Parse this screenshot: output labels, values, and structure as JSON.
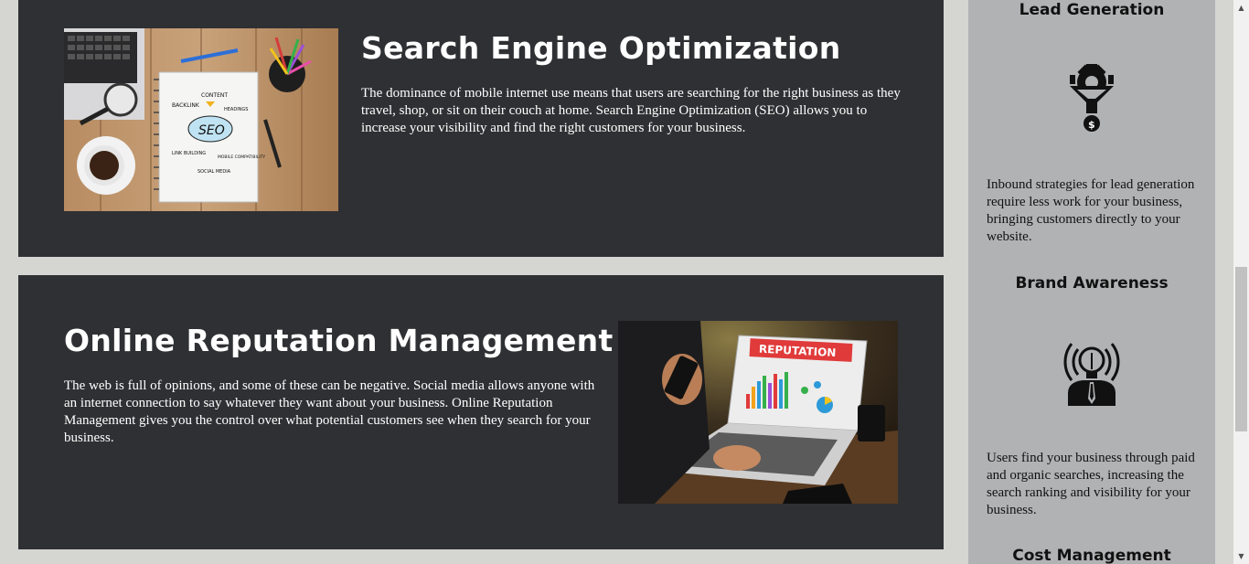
{
  "services": {
    "seo": {
      "title": "Search Engine Optimization",
      "description": "The dominance of mobile internet use means that users are searching for the right business as they travel, shop, or sit on their couch at home. Search Engine Optimization (SEO) allows you to increase your visibility and find the right customers for your business.",
      "image_alt": "SEO notebook on a wooden desk",
      "image_words": [
        "SEO",
        "BACKLINK",
        "CONTENT",
        "HEADINGS",
        "LINK BUILDING",
        "MOBILE COMPATIBILITY",
        "SOCIAL MEDIA"
      ]
    },
    "orm": {
      "title": "Online Reputation Management",
      "description": "The web is full of opinions, and some of these can be negative. Social media allows anyone with an internet connection to say whatever they want about your business. Online Reputation Management gives you the control over what potential customers see when they search for your business.",
      "image_alt": "Laptop showing reputation charts",
      "image_words": [
        "REPUTATION"
      ]
    }
  },
  "sidebar": {
    "benefits": [
      {
        "title": "Lead Generation",
        "icon": "funnel-gear-icon",
        "description": "Inbound strategies for lead generation require less work for your business, bringing customers directly to your website."
      },
      {
        "title": "Brand Awareness",
        "icon": "lightbulb-person-icon",
        "description": "Users find your business through paid and organic searches, increasing the search ranking and visibility for your business."
      },
      {
        "title": "Cost Management",
        "icon": "",
        "description": ""
      }
    ]
  },
  "colors": {
    "page_bg": "#d5d6d2",
    "card_bg": "#2f3033",
    "sidebar_bg": "#b1b2b4",
    "text_light": "#ffffff",
    "text_dark": "#111111"
  }
}
